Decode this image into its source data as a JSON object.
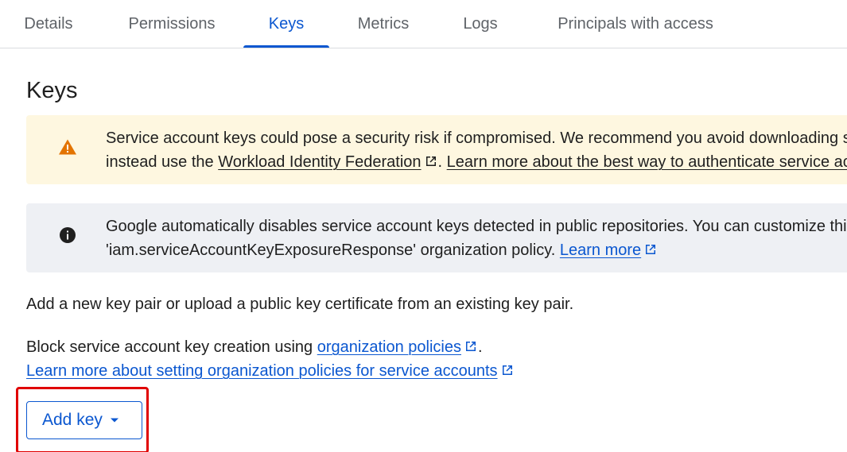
{
  "tabs": {
    "details": "Details",
    "permissions": "Permissions",
    "keys": "Keys",
    "metrics": "Metrics",
    "logs": "Logs",
    "principals": "Principals with access",
    "active": "Keys"
  },
  "section_title": "Keys",
  "warning_banner": {
    "icon": "warning-icon",
    "line1": "Service account keys could pose a security risk if compromised. We recommend you avoid downloading service account keys and",
    "line2_prefix": "instead use the ",
    "workload_link": "Workload Identity Federation",
    "line2_separator": ". ",
    "learn_link": "Learn more about the best way to authenticate service accounts on Google Cloud here."
  },
  "info_banner": {
    "icon": "info-icon",
    "line1": "Google automatically disables service account keys detected in public repositories. You can customize this behavior by using the",
    "line2_prefix": "'iam.serviceAccountKeyExposureResponse' organization policy. ",
    "learn_link": "Learn more"
  },
  "add_pair_text": "Add a new key pair or upload a public key certificate from an existing key pair.",
  "block_text_prefix": "Block service account key creation using ",
  "org_policies_link": "organization policies",
  "block_text_suffix": ".",
  "learn_org_link": "Learn more about setting organization policies for service accounts",
  "add_key_button": "Add key",
  "colors": {
    "accent": "#0b57d0",
    "warning_bg": "#fef7e0",
    "warning_icon": "#e37400",
    "info_bg": "#eef0f4",
    "highlight": "#e00000"
  }
}
